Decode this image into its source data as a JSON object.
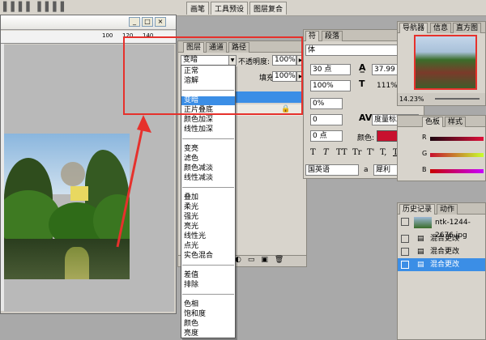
{
  "topbar": {
    "tabs": [
      "画笔",
      "工具预设",
      "图层复合"
    ]
  },
  "layers": {
    "tabs": [
      "图层",
      "通道",
      "路径"
    ],
    "blend_value": "变暗",
    "opacity_label": "不透明度:",
    "opacity_value": "100%",
    "fill_label": "填充:",
    "fill_value": "100%"
  },
  "blend_modes": {
    "group1": [
      "正常",
      "溶解"
    ],
    "group2": [
      "变暗",
      "正片叠底",
      "颜色加深",
      "线性加深"
    ],
    "group3": [
      "变亮",
      "滤色",
      "颜色减淡",
      "线性减淡"
    ],
    "group4": [
      "叠加",
      "柔光",
      "强光",
      "亮光",
      "线性光",
      "点光",
      "实色混合"
    ],
    "group5": [
      "差值",
      "排除"
    ],
    "group6": [
      "色相",
      "饱和度",
      "颜色",
      "亮度"
    ],
    "selected": "变暗"
  },
  "character": {
    "tabs": [
      "符",
      "段落"
    ],
    "font_family": "体",
    "size": "30 点",
    "leading": "37.99 点",
    "scale_v": "100%",
    "scale_h": "111%",
    "tracking": "0%",
    "kerning": "0",
    "kerning_mode": "度量标准",
    "baseline": "0 点",
    "color_label": "颜色:",
    "color_swatch": "#c8102e",
    "language": "国英语",
    "aa_label": "a",
    "aa_mode": "犀利",
    "style_buttons": [
      "T",
      "T",
      "TT",
      "Tr",
      "T'",
      "T,",
      "T",
      "Ŧ"
    ]
  },
  "navigator": {
    "tabs": [
      "导航器",
      "信息",
      "直方图"
    ],
    "zoom": "14.23%"
  },
  "color_panel": {
    "tabs": [
      "色板",
      "样式"
    ],
    "channels": [
      "R",
      "G",
      "B"
    ]
  },
  "history": {
    "tabs": [
      "历史记录",
      "动作"
    ],
    "snapshot": "ntk-1244-2676.jpg",
    "items": [
      "混合更改",
      "混合更改",
      "混合更改"
    ]
  },
  "document": {
    "ruler_marks": [
      "100",
      "120",
      "140"
    ]
  }
}
